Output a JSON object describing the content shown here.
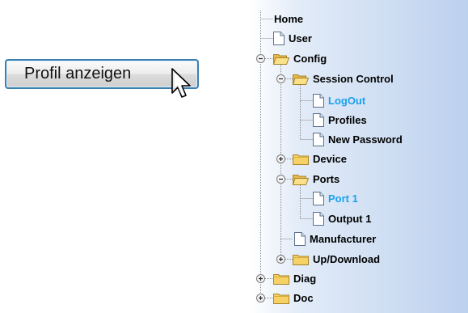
{
  "button": {
    "label": "Profil anzeigen"
  },
  "tree": {
    "nodes": [
      {
        "label": "Home",
        "type": "none",
        "active": false
      },
      {
        "label": "User",
        "type": "file",
        "active": false
      },
      {
        "label": "Config",
        "type": "folder",
        "expanded": true,
        "active": false
      },
      {
        "label": "Session Control",
        "type": "folder",
        "expanded": true,
        "active": false
      },
      {
        "label": "LogOut",
        "type": "file",
        "active": true
      },
      {
        "label": "Profiles",
        "type": "file",
        "active": false
      },
      {
        "label": "New Password",
        "type": "file",
        "active": false
      },
      {
        "label": "Device",
        "type": "folder",
        "expanded": false,
        "active": false
      },
      {
        "label": "Ports",
        "type": "folder",
        "expanded": true,
        "active": false
      },
      {
        "label": "Port 1",
        "type": "file",
        "active": true
      },
      {
        "label": "Output 1",
        "type": "file",
        "active": false
      },
      {
        "label": "Manufacturer",
        "type": "file",
        "active": false
      },
      {
        "label": "Up/Download",
        "type": "folder",
        "expanded": false,
        "active": false
      },
      {
        "label": "Diag",
        "type": "folder",
        "expanded": false,
        "active": false
      },
      {
        "label": "Doc",
        "type": "folder",
        "expanded": false,
        "active": false
      }
    ]
  },
  "colors": {
    "active_link": "#1aa0ee",
    "button_border": "#3c7fb1",
    "folder": "#f6d266"
  }
}
